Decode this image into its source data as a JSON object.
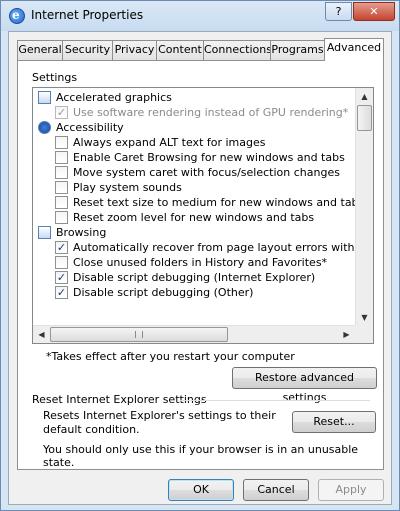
{
  "window": {
    "title": "Internet Properties",
    "help_button": "?",
    "close_button": "✕"
  },
  "tabs": [
    {
      "label": "General"
    },
    {
      "label": "Security"
    },
    {
      "label": "Privacy"
    },
    {
      "label": "Content"
    },
    {
      "label": "Connections"
    },
    {
      "label": "Programs"
    },
    {
      "label": "Advanced",
      "active": true
    }
  ],
  "settings": {
    "label": "Settings",
    "rows": [
      {
        "type": "category",
        "icon": "monitor-icon",
        "label": "Accelerated graphics"
      },
      {
        "type": "checkbox",
        "checked": true,
        "label": "Use software rendering instead of GPU rendering*",
        "disabled": true
      },
      {
        "type": "category",
        "icon": "accessibility-icon",
        "label": "Accessibility"
      },
      {
        "type": "checkbox",
        "checked": false,
        "label": "Always expand ALT text for images"
      },
      {
        "type": "checkbox",
        "checked": false,
        "label": "Enable Caret Browsing for new windows and tabs"
      },
      {
        "type": "checkbox",
        "checked": false,
        "label": "Move system caret with focus/selection changes"
      },
      {
        "type": "checkbox",
        "checked": false,
        "label": "Play system sounds"
      },
      {
        "type": "checkbox",
        "checked": false,
        "label": "Reset text size to medium for new windows and tabs"
      },
      {
        "type": "checkbox",
        "checked": false,
        "label": "Reset zoom level for new windows and tabs"
      },
      {
        "type": "category",
        "icon": "browsing-icon",
        "label": "Browsing"
      },
      {
        "type": "checkbox",
        "checked": true,
        "label": "Automatically recover from page layout errors with Compa"
      },
      {
        "type": "checkbox",
        "checked": false,
        "label": "Close unused folders in History and Favorites*"
      },
      {
        "type": "checkbox",
        "checked": true,
        "label": "Disable script debugging (Internet Explorer)"
      },
      {
        "type": "checkbox",
        "checked": true,
        "label": "Disable script debugging (Other)"
      }
    ],
    "restart_note": "*Takes effect after you restart your computer",
    "restore_button": "Restore advanced settings"
  },
  "reset": {
    "header": "Reset Internet Explorer settings",
    "description": "Resets Internet Explorer's settings to their default condition.",
    "button": "Reset...",
    "unusable_note": "You should only use this if your browser is in an unusable state."
  },
  "footer": {
    "ok": "OK",
    "cancel": "Cancel",
    "apply": "Apply"
  }
}
